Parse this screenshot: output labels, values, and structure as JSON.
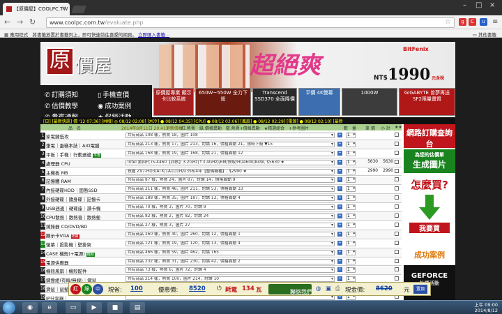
{
  "browser": {
    "tab_title": "【原價屋】COOLPC.TW",
    "url_host": "www.coolpc.com.tw",
    "url_path": "/evaluate.php",
    "bookmarks_label": "應用程式",
    "bookmarks_hint": "將書籤放置於書籤列上，即可快速前往喜愛的網頁。",
    "bookmarks_link": "立即匯入書籤...",
    "other_bookmarks": "其他書籤"
  },
  "site": {
    "logo_char": "原",
    "logo_text": "價屋",
    "banner_title": "超絕爽",
    "brand": "BitFenix",
    "price_prefix": "NT$",
    "price_value": "1990",
    "price_suffix": "元含稅",
    "nav": [
      {
        "label": "訂購須知",
        "icon": "✆"
      },
      {
        "label": "手機查價",
        "icon": "▯"
      },
      {
        "label": "估價教學",
        "icon": "✆"
      },
      {
        "label": "成功案例",
        "icon": "◉"
      },
      {
        "label": "貴賓通報",
        "icon": "✆"
      },
      {
        "label": "促銷活動",
        "icon": "★"
      }
    ],
    "ads": [
      {
        "text": "原價屋專業 顯示卡比較系統"
      },
      {
        "text": "650W~550W 全力下殺"
      },
      {
        "text": "Transcend SSD370 全面降價"
      },
      {
        "text": "平價 4K螢幕"
      },
      {
        "text": "1000W"
      },
      {
        "text": "GIGABYTE 曾夢再送 SF2限量畫質"
      }
    ],
    "status_line": "[日] [最新快訊]  價 '12 07:36]  [M相] ◎ 08/12 02:08]  [水冷] ● 08/12 04:35]  [CPU] ● 08/12 03:06]  [風扇] ● 08/12 02:29]  [電源] ● 08/12 02:10]  [最新"
  },
  "table": {
    "header_name": "品　名",
    "header_date": "2014年8月11日 20:41更新價格",
    "header_mid": "紅.熱賣　綠.價格異動　藍.熱賣+價格異動　★精選組合　+參考圖片",
    "header_qty": "數　量",
    "header_price": "單 價",
    "header_subtotal": "小 計",
    "header_check": "★★",
    "rows": [
      {
        "n": "1",
        "cat": "家電鍵低攻",
        "badge": "",
        "sel": "共有商品 108 樣，熱賣 18，圖片 108",
        "qty": "1",
        "price": "",
        "sub": "",
        "color": ""
      },
      {
        "n": "2",
        "cat": "筆電｜蛋糕本誌｜AIO電腦",
        "badge": "",
        "sel": "共有商品 213 樣，熱賣 17，圖片 213，討論 16，價格異動 21，限時下殺 ▼15",
        "qty": "1",
        "price": "",
        "sub": "",
        "color": ""
      },
      {
        "n": "3",
        "cat": "平板｜手機｜行動週邊",
        "badge": "平板",
        "sel": "共有商品 168 樣，熱賣 19，圖片 168，討論 21，價格異動 12",
        "qty": "1",
        "price": "",
        "sub": "",
        "color": ""
      },
      {
        "n": "4",
        "cat": "處理器 CPU",
        "badge": "",
        "sel": "Intel 第四代 i5-4460【四核】3.2GHz(↑3.4GHz)/6M/快取/HD4600/84W, $5630 ★",
        "qty": "1",
        "price": "5630",
        "sub": "5630",
        "color": ""
      },
      {
        "n": "5",
        "cat": "主機板 MB",
        "badge": "",
        "sel": "技嘉 Z97-HD3/ATX/1A1D1H/U3S6/4年【整備機種】, $2990 ★",
        "qty": "1",
        "price": "2990",
        "sub": "2990",
        "color": ""
      },
      {
        "n": "6",
        "cat": "記憶體 RAM",
        "badge": "",
        "sel": "共有商品 87 樣，熱賣 24，圖片 87，討論 14，價格異動 9",
        "qty": "1",
        "price": "",
        "sub": "",
        "color": ""
      },
      {
        "n": "7",
        "cat": "內接硬碟HDD｜固態SSD",
        "badge": "",
        "sel": "共有商品 211 樣，熱賣 46，圖片 211，討論 53，價格異動 33",
        "qty": "1",
        "price": "",
        "sub": "",
        "color": ""
      },
      {
        "n": "8",
        "cat": "外接硬碟｜隨身碟｜記憶卡",
        "badge": "",
        "sel": "共有商品 188 樣，熱賣 35，圖片 187，討論 13，價格異動 4",
        "qty": "1",
        "price": "",
        "sub": "",
        "color": ""
      },
      {
        "n": "9",
        "cat": "USB週邊｜硬碟座｜讀卡機",
        "badge": "",
        "sel": "共有商品 70 樣，熱賣 3，圖片 70，討論 9",
        "qty": "1",
        "price": "",
        "sub": "",
        "color": ""
      },
      {
        "n": "10",
        "cat": "CPU散熱｜散熱膏｜散熱墊",
        "badge": "",
        "sel": "共有商品 82 樣，熱賣 2，圖片 82，討論 24",
        "qty": "1",
        "price": "",
        "sub": "",
        "color": ""
      },
      {
        "n": "11",
        "cat": "燒錄器 CD/DVD/BD",
        "badge": "",
        "sel": "共有商品 27 樣，熱賣 3，圖片 27",
        "qty": "1",
        "price": "",
        "sub": "",
        "color": ""
      },
      {
        "n": "12",
        "cat": "顯示卡VGA",
        "badge": "熱賣",
        "sel": "共有商品 260 樣，熱賣 40，圖片 260，討論 12，價格異動 1",
        "qty": "1",
        "price": "",
        "sub": "",
        "color": "red"
      },
      {
        "n": "13",
        "cat": "螢幕｜投影機｜壁掛架",
        "badge": "",
        "sel": "共有商品 121 樣，熱賣 19，圖片 120，討論 13，價格異動 4",
        "qty": "1",
        "price": "",
        "sub": "",
        "color": "green"
      },
      {
        "n": "14",
        "cat": "CASE 機殼(+電源)",
        "badge": "機殼",
        "sel": "共有商品 466 樣，熱賣 59，圖片 462，討論 165",
        "qty": "1",
        "price": "",
        "sub": "",
        "color": ""
      },
      {
        "n": "15",
        "cat": "電源供應器",
        "badge": "",
        "sel": "共有商品 232 樣，熱賣 31，圖片 230，討論 42，價格異動 2",
        "qty": "1",
        "price": "",
        "sub": "",
        "color": "red"
      },
      {
        "n": "16",
        "cat": "機殼風扇｜機殼配件",
        "badge": "",
        "sel": "共有商品 73 樣，熱賣 6，圖片 72，討論 4",
        "qty": "1",
        "price": "",
        "sub": "",
        "color": ""
      },
      {
        "n": "17",
        "cat": "鍵盤組(有線/無線)｜鍵鼠",
        "badge": "",
        "sel": "共有商品 214 樣，熱賣 100，圖片 214，討論 10",
        "qty": "1",
        "price": "",
        "sub": "",
        "color": ""
      },
      {
        "n": "18",
        "cat": "滑鼠｜鼠墊｜",
        "badge": "",
        "sel": "",
        "qty": "1",
        "price": "",
        "sub": "",
        "color": ""
      },
      {
        "n": "19",
        "cat": "IP分享器｜",
        "badge": "",
        "sel": "",
        "qty": "1",
        "price": "",
        "sub": "",
        "color": ""
      }
    ]
  },
  "sidebar": {
    "online_order": "網路訂購查詢台",
    "gen_image": "生成圖片",
    "gen_sub": "為您的估價單",
    "how_buy": "怎麼買?",
    "how_buy_sub": "我要買",
    "success": "成功案例",
    "geforce": "GEFORCE",
    "geforce_sub": "抽獎活動"
  },
  "bottombar": {
    "c1": "紅",
    "c2": "綠",
    "c3": "中",
    "cash_label": "現省:",
    "cash_value": "100",
    "discount_label": "優惠價:",
    "discount_value": "8520",
    "power_label": "耗電",
    "power_value": "134",
    "power_unit": "瓦",
    "contact": "聯絡我們",
    "cash_price_label": "現金價:",
    "cash_price_value": "8620",
    "cash_unit": "元",
    "save": "置頂"
  },
  "taskbar": {
    "time": "上午 09:00",
    "date": "2014/8/12"
  }
}
